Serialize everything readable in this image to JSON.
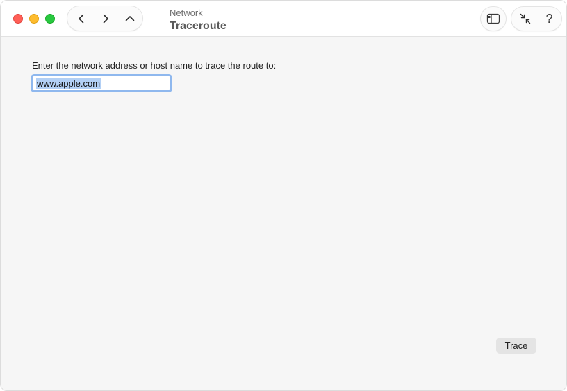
{
  "window": {
    "subtitle": "Network",
    "title": "Traceroute"
  },
  "toolbar": {
    "back_icon": "chevron-left-icon",
    "forward_icon": "chevron-right-icon",
    "up_icon": "chevron-up-icon",
    "sidebar_icon": "sidebar-icon",
    "shrink_icon": "shrink-arrows-icon",
    "help_label": "?"
  },
  "form": {
    "prompt": "Enter the network address or host name to trace the route to:",
    "address_value": "www.apple.com"
  },
  "actions": {
    "trace_label": "Trace"
  },
  "colors": {
    "close": "#ff5f57",
    "minimize": "#febc2e",
    "maximize": "#28c840",
    "focus_ring": "#8fb8ee",
    "selection": "#b3d0f5"
  }
}
